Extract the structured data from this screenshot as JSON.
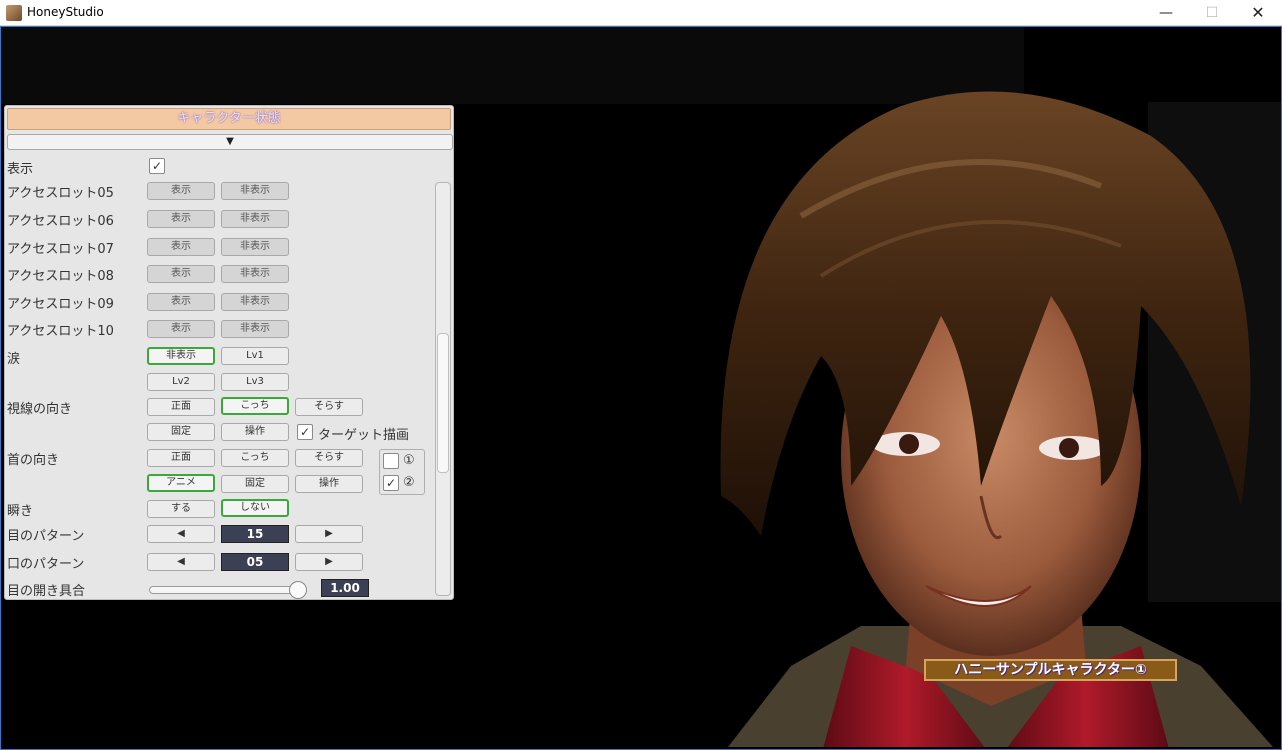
{
  "window": {
    "title": "HoneyStudio",
    "minimize": "—",
    "maximize": "☐",
    "close": "✕"
  },
  "panel": {
    "header": "キャラクター状態",
    "collapse": "▼",
    "display": {
      "label": "表示",
      "checked": "✓"
    },
    "slots": [
      {
        "label": "アクセスロット05",
        "show": "表示",
        "hide": "非表示"
      },
      {
        "label": "アクセスロット06",
        "show": "表示",
        "hide": "非表示"
      },
      {
        "label": "アクセスロット07",
        "show": "表示",
        "hide": "非表示"
      },
      {
        "label": "アクセスロット08",
        "show": "表示",
        "hide": "非表示"
      },
      {
        "label": "アクセスロット09",
        "show": "表示",
        "hide": "非表示"
      },
      {
        "label": "アクセスロット10",
        "show": "表示",
        "hide": "非表示"
      }
    ],
    "tears": {
      "label": "涙",
      "options": [
        "非表示",
        "Lv1",
        "Lv2",
        "Lv3"
      ],
      "selected": "非表示"
    },
    "gaze": {
      "label": "視線の向き",
      "options": [
        "正面",
        "こっち",
        "そらす",
        "固定",
        "操作"
      ],
      "selected": "こっち",
      "target_draw": {
        "label": "ターゲット描画",
        "checked": "✓"
      }
    },
    "neck": {
      "label": "首の向き",
      "options": [
        "正面",
        "こっち",
        "そらす",
        "アニメ",
        "固定",
        "操作"
      ],
      "selected": "アニメ",
      "opt1": {
        "label": "①",
        "checked": ""
      },
      "opt2": {
        "label": "②",
        "checked": "✓"
      }
    },
    "blink": {
      "label": "瞬き",
      "options": [
        "する",
        "しない"
      ],
      "selected": "しない"
    },
    "eye_pattern": {
      "label": "目のパターン",
      "prev": "◀",
      "value": "15",
      "next": "▶"
    },
    "mouth_pattern": {
      "label": "口のパターン",
      "prev": "◀",
      "value": "05",
      "next": "▶"
    },
    "eye_open": {
      "label": "目の開き具合",
      "value": "1.00",
      "slider_fraction": 1.0
    }
  },
  "character": {
    "name_tag": "ハニーサンプルキャラクター①"
  },
  "colors": {
    "header_bg": "#f3c9a3",
    "selected_border": "#3aa83a",
    "numbox_bg": "#3c4054",
    "name_tag_bg": "#8a5a18"
  }
}
